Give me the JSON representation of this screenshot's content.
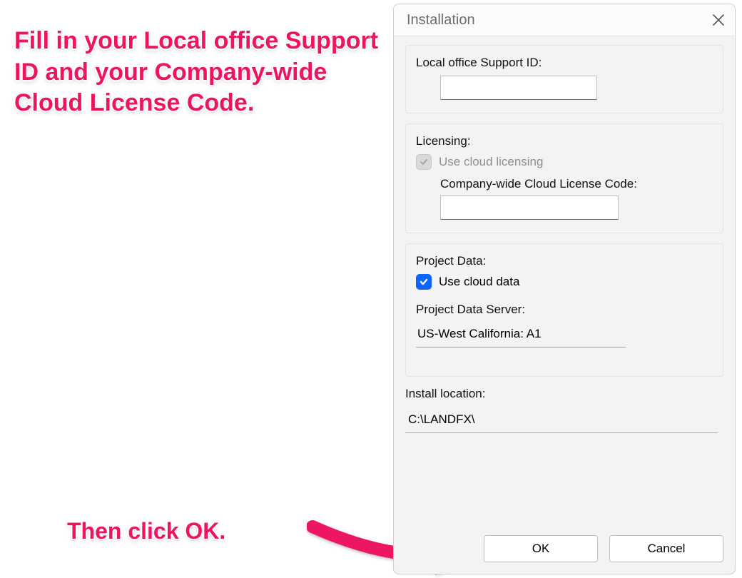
{
  "overlay": {
    "instruction_main": "Fill in your Local office Support ID and your Company-wide Cloud License Code.",
    "instruction_bottom": "Then click OK."
  },
  "dialog": {
    "title": "Installation",
    "support_id": {
      "label": "Local office Support ID:",
      "value": ""
    },
    "licensing": {
      "section_label": "Licensing:",
      "use_cloud_checkbox_label": "Use cloud licensing",
      "use_cloud_checked": false,
      "code_label": "Company-wide Cloud License Code:",
      "code_value": ""
    },
    "project_data": {
      "section_label": "Project Data:",
      "use_cloud_data_label": "Use cloud data",
      "use_cloud_data_checked": true,
      "server_label": "Project Data Server:",
      "server_value": "US-West California: A1"
    },
    "install_location": {
      "label": "Install location:",
      "value": "C:\\LANDFX\\"
    },
    "buttons": {
      "ok": "OK",
      "cancel": "Cancel"
    }
  }
}
